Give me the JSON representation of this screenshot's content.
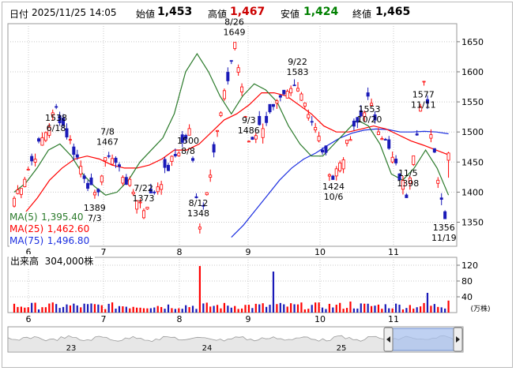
{
  "header": {
    "date_label": "日付",
    "datetime": "2025/11/25 14:05",
    "open_label": "始値",
    "open": "1,453",
    "high_label": "高値",
    "high": "1,467",
    "low_label": "安値",
    "low": "1,424",
    "close_label": "終値",
    "close": "1,465"
  },
  "legend": {
    "ma5_label": "MA(5)",
    "ma5_value": "1,395.40",
    "ma25_label": "MA(25)",
    "ma25_value": "1,462.60",
    "ma75_label": "MA(75)",
    "ma75_value": "1,496.80"
  },
  "volume_label": "出来高",
  "volume_value": "304,000株",
  "volume_unit": "(万株)",
  "colors": {
    "up": "#ff0000",
    "down": "#1a1ab8",
    "ma5": "#2a7a2a",
    "ma25": "#ff0000",
    "ma75": "#1c2fe0",
    "high_value": "#cc0000",
    "low_value": "#008000"
  },
  "chart_data": [
    {
      "type": "candlestick",
      "title": "",
      "ylim": [
        1310,
        1680
      ],
      "y_ticks": [
        "1650",
        "1600",
        "1550",
        "1500",
        "1450",
        "1400",
        "1350"
      ],
      "x_month_labels": [
        "6",
        "7",
        "8",
        "9",
        "10",
        "11"
      ],
      "annotations": [
        {
          "date": "6/18",
          "value": "1538"
        },
        {
          "date": "7/3",
          "value": "1389"
        },
        {
          "date": "7/8",
          "value": "1467"
        },
        {
          "date": "7/22",
          "value": "1373"
        },
        {
          "date": "8/8",
          "value": "1500"
        },
        {
          "date": "8/12",
          "value": "1348"
        },
        {
          "date": "8/26",
          "value": "1649"
        },
        {
          "date": "9/3",
          "value": "1486"
        },
        {
          "date": "9/22",
          "value": "1583"
        },
        {
          "date": "10/6",
          "value": "1424"
        },
        {
          "date": "10/20",
          "value": "1553"
        },
        {
          "date": "11/5",
          "value": "1398"
        },
        {
          "date": "11/11",
          "value": "1577"
        },
        {
          "date": "11/19",
          "value": "1356"
        }
      ],
      "last_candle": {
        "open": 1453,
        "high": 1467,
        "low": 1424,
        "close": 1465
      },
      "ma5_last": 1395.4,
      "ma25_last": 1462.6,
      "ma75_last": 1496.8,
      "ma_series_anchors": {
        "ma5": [
          1400,
          1415,
          1440,
          1470,
          1480,
          1460,
          1430,
          1410,
          1395,
          1400,
          1420,
          1450,
          1470,
          1490,
          1530,
          1600,
          1630,
          1600,
          1560,
          1530,
          1560,
          1580,
          1570,
          1550,
          1510,
          1480,
          1460,
          1460,
          1480,
          1500,
          1520,
          1510,
          1480,
          1430,
          1420,
          1440,
          1470,
          1440,
          1395
        ],
        "ma25": [
          1365,
          1390,
          1420,
          1440,
          1455,
          1460,
          1455,
          1445,
          1440,
          1440,
          1445,
          1455,
          1470,
          1470,
          1480,
          1500,
          1520,
          1530,
          1545,
          1565,
          1565,
          1560,
          1545,
          1530,
          1510,
          1500,
          1500,
          1505,
          1510,
          1505,
          1495,
          1485,
          1478,
          1470,
          1462
        ],
        "ma75": [
          1325,
          1345,
          1370,
          1395,
          1420,
          1440,
          1455,
          1465,
          1478,
          1490,
          1498,
          1503,
          1505,
          1504,
          1500,
          1500,
          1501,
          1500,
          1497
        ]
      }
    },
    {
      "type": "bar",
      "title": "出来高",
      "ylim": [
        0,
        140
      ],
      "y_ticks": [
        "120",
        "80",
        "40"
      ],
      "x_month_labels": [
        "6",
        "7",
        "8",
        "9",
        "10",
        "11"
      ],
      "spikes": [
        {
          "month": "8",
          "value": 118
        },
        {
          "month": "9",
          "value": 104
        },
        {
          "month": "10",
          "value": 28
        },
        {
          "month": "11",
          "value": 50
        }
      ],
      "last_volume": 30.4
    },
    {
      "type": "area",
      "title": "",
      "x_labels": [
        "23",
        "24",
        "25"
      ]
    }
  ]
}
